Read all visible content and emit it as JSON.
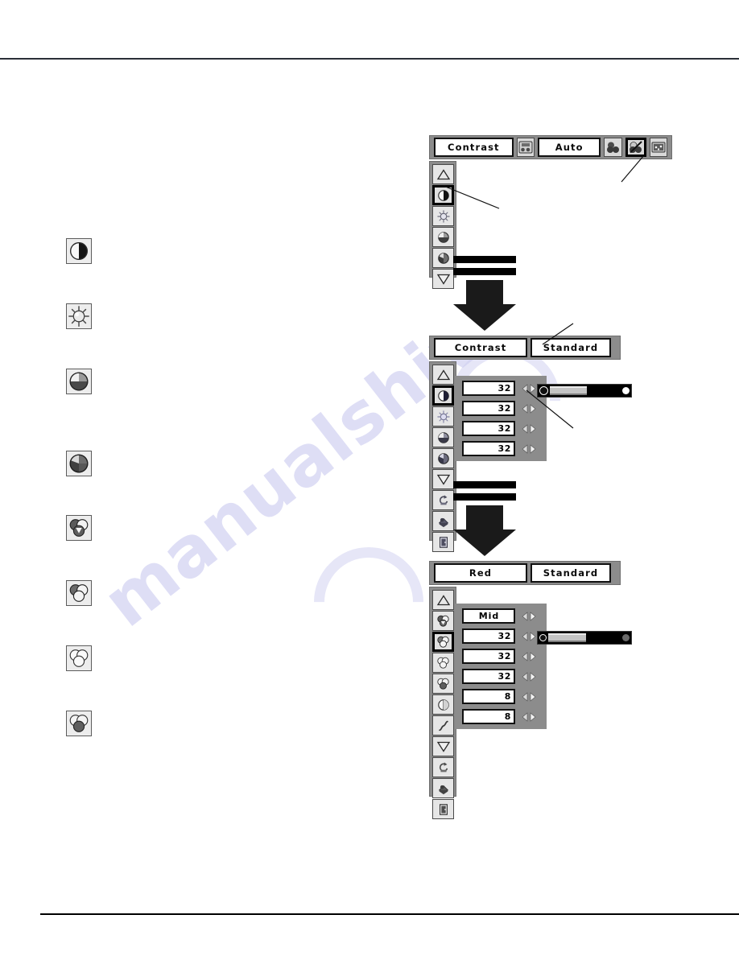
{
  "page": {
    "watermark": "manualshive.com"
  },
  "legend_icons": [
    {
      "name": "contrast-icon",
      "label": "Contrast"
    },
    {
      "name": "brightness-icon",
      "label": "Brightness"
    },
    {
      "name": "color-temp-icon",
      "label": "Color temp."
    },
    {
      "name": "white-balance-icon",
      "label": "White balance"
    },
    {
      "name": "white-balance-red-icon",
      "label": "White balance (Red)"
    },
    {
      "name": "white-balance-green-icon",
      "label": "White balance (Green)"
    },
    {
      "name": "white-balance-blue-icon",
      "label": "White balance (Blue)"
    },
    {
      "name": "offset-icon",
      "label": "Offset"
    }
  ],
  "panel1": {
    "title": "Contrast",
    "mode_value": "Auto",
    "header_icons": [
      {
        "name": "image-select-icon",
        "selected": false
      },
      {
        "name": "image-adjust-icon",
        "selected": false
      },
      {
        "name": "image-adjust-slash-icon",
        "selected": true
      },
      {
        "name": "screen-icon",
        "selected": false
      }
    ],
    "rail": [
      {
        "name": "scroll-up-icon",
        "selected": false
      },
      {
        "name": "contrast-icon",
        "selected": true
      },
      {
        "name": "brightness-icon",
        "selected": false
      },
      {
        "name": "color-temp-icon",
        "selected": false
      },
      {
        "name": "white-balance-icon",
        "selected": false
      },
      {
        "name": "scroll-down-icon",
        "selected": false
      }
    ]
  },
  "panel2": {
    "title": "Contrast",
    "mode_value": "Standard",
    "rows": [
      {
        "name": "contrast-value",
        "value": "32"
      },
      {
        "name": "brightness-value",
        "value": "32"
      },
      {
        "name": "color-temp-value",
        "value": "32"
      },
      {
        "name": "white-balance-value",
        "value": "32"
      }
    ],
    "slider": {
      "name": "contrast-slider",
      "fill_percent": 52
    },
    "rail": [
      {
        "name": "scroll-up-icon",
        "selected": false
      },
      {
        "name": "contrast-icon",
        "selected": true
      },
      {
        "name": "brightness-icon",
        "selected": false
      },
      {
        "name": "color-temp-icon",
        "selected": false
      },
      {
        "name": "white-balance-icon",
        "selected": false
      },
      {
        "name": "scroll-down-icon",
        "selected": false
      },
      {
        "name": "reset-icon",
        "selected": false
      },
      {
        "name": "store-icon",
        "selected": false
      },
      {
        "name": "quit-icon",
        "selected": false
      }
    ]
  },
  "panel3": {
    "title": "Red",
    "mode_value": "Standard",
    "rows": [
      {
        "name": "gamma-level-value",
        "value": "Mid",
        "center": true
      },
      {
        "name": "red-value",
        "value": "32",
        "center": false
      },
      {
        "name": "green-value",
        "value": "32",
        "center": false
      },
      {
        "name": "blue-value",
        "value": "32",
        "center": false
      },
      {
        "name": "sharpness-value",
        "value": "8",
        "center": false
      },
      {
        "name": "gamma-value",
        "value": "8",
        "center": false
      }
    ],
    "slider": {
      "name": "red-slider",
      "fill_percent": 52
    },
    "rail": [
      {
        "name": "scroll-up-icon",
        "selected": false
      },
      {
        "name": "white-balance-red-icon",
        "selected": false
      },
      {
        "name": "white-balance-red-sel-icon",
        "selected": true
      },
      {
        "name": "white-balance-green-icon",
        "selected": false
      },
      {
        "name": "white-balance-blue-icon",
        "selected": false
      },
      {
        "name": "sharpness-icon",
        "selected": false
      },
      {
        "name": "gamma-icon",
        "selected": false
      },
      {
        "name": "scroll-down-icon",
        "selected": false
      },
      {
        "name": "reset-icon",
        "selected": false
      },
      {
        "name": "store-icon",
        "selected": false
      },
      {
        "name": "quit-icon",
        "selected": false
      }
    ]
  }
}
